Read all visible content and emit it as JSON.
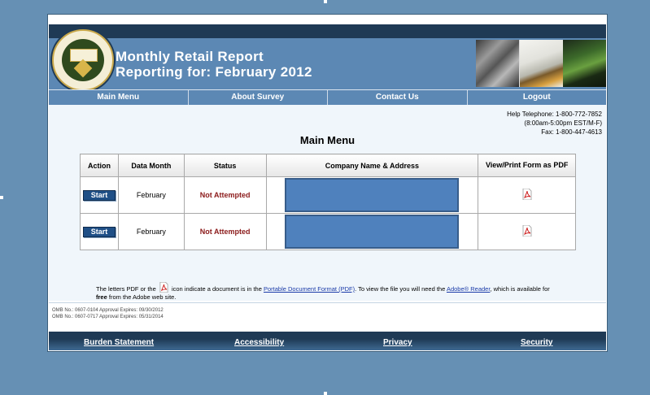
{
  "header": {
    "title_line_1": "Monthly Retail Report",
    "title_line_2": "Reporting for: February 2012",
    "seal_text": "U.S. DEPARTMENT OF COMMERCE BUREAU OF THE CENSUS"
  },
  "nav": {
    "items": [
      "Main Menu",
      "About Survey",
      "Contact Us",
      "Logout"
    ]
  },
  "help": {
    "telephone": "Help Telephone: 1-800-772-7852",
    "hours": "(8:00am-5:00pm EST/M-F)",
    "fax": "Fax: 1-800-447-4613"
  },
  "main": {
    "title": "Main Menu",
    "table": {
      "headers": [
        "Action",
        "Data Month",
        "Status",
        "Company Name & Address",
        "View/Print Form as PDF"
      ],
      "rows": [
        {
          "action": "Start",
          "month": "February",
          "status": "Not Attempted"
        },
        {
          "action": "Start",
          "month": "February",
          "status": "Not Attempted"
        }
      ]
    }
  },
  "note": {
    "p1": "The letters PDF or the",
    "p2": "icon indicate a document is in the",
    "link1": "Portable Document Format (PDF)",
    "p3": ". To view the file you will need the",
    "link2": "Adobe® Reader",
    "p4": ", which is available for",
    "bold": "free",
    "p5": "from the Adobe web site."
  },
  "omb": {
    "line1": "OMB No.: 0607-0104 Approval Expires: 09/30/2012",
    "line2": "OMB No.: 0607-0717 Approval Expires: 05/31/2014"
  },
  "footer": {
    "links": [
      "Burden Statement",
      "Accessibility",
      "Privacy",
      "Security"
    ]
  },
  "colors": {
    "background": "#6690b4",
    "header": "#5c88b4",
    "band": "#1f3a55",
    "start_button": "#1f4f86",
    "status": "#8b1a1a",
    "company_box": "#4f81bd"
  }
}
